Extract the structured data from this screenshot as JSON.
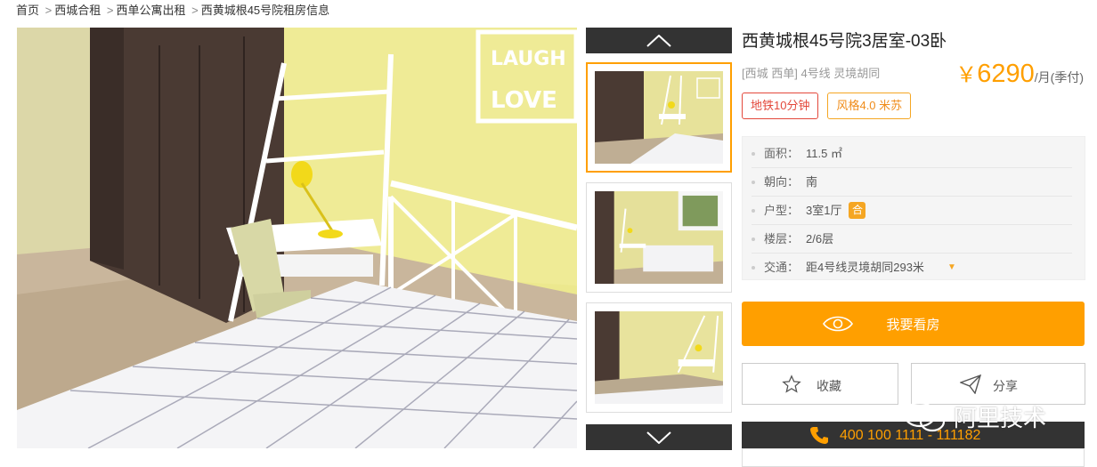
{
  "breadcrumb": {
    "items": [
      {
        "label": "首页"
      },
      {
        "label": "西城合租"
      },
      {
        "label": "西单公寓出租"
      },
      {
        "label": "西黄城根45号院租房信息"
      }
    ],
    "separator": ">"
  },
  "main_photo": {
    "wall_sign_line1": "LAUGH",
    "wall_sign_line2": "LOVE"
  },
  "thumbnails": {
    "up_icon": "chevron-up-icon",
    "down_icon": "chevron-down-icon",
    "count_visible": 3,
    "active_index": 0
  },
  "listing": {
    "title": "西黄城根45号院3居室-03卧",
    "location": "[西城 西单] 4号线 灵境胡同",
    "price_currency": "￥",
    "price_value": "6290",
    "price_unit": "/月(季付)",
    "tags": [
      {
        "label": "地铁10分钟",
        "color": "#e3483b"
      },
      {
        "label": "风格4.0 米苏",
        "color": "#f08c1a"
      }
    ],
    "details": [
      {
        "key": "面积：",
        "value": "11.5 ㎡"
      },
      {
        "key": "朝向：",
        "value": "南"
      },
      {
        "key": "户型：",
        "value": "3室1厅",
        "badge": "合"
      },
      {
        "key": "楼层：",
        "value": "2/6层"
      },
      {
        "key": "交通：",
        "value": "距4号线灵境胡同293米"
      }
    ]
  },
  "actions": {
    "view_label": "我要看房",
    "collect_label": "收藏",
    "share_label": "分享",
    "phone": "400 100 1111 - 111182"
  },
  "watermark": {
    "text": "阿里技术"
  },
  "colors": {
    "accent": "#ff9f00",
    "dark_bar": "#333333",
    "tag_red": "#e3483b"
  }
}
